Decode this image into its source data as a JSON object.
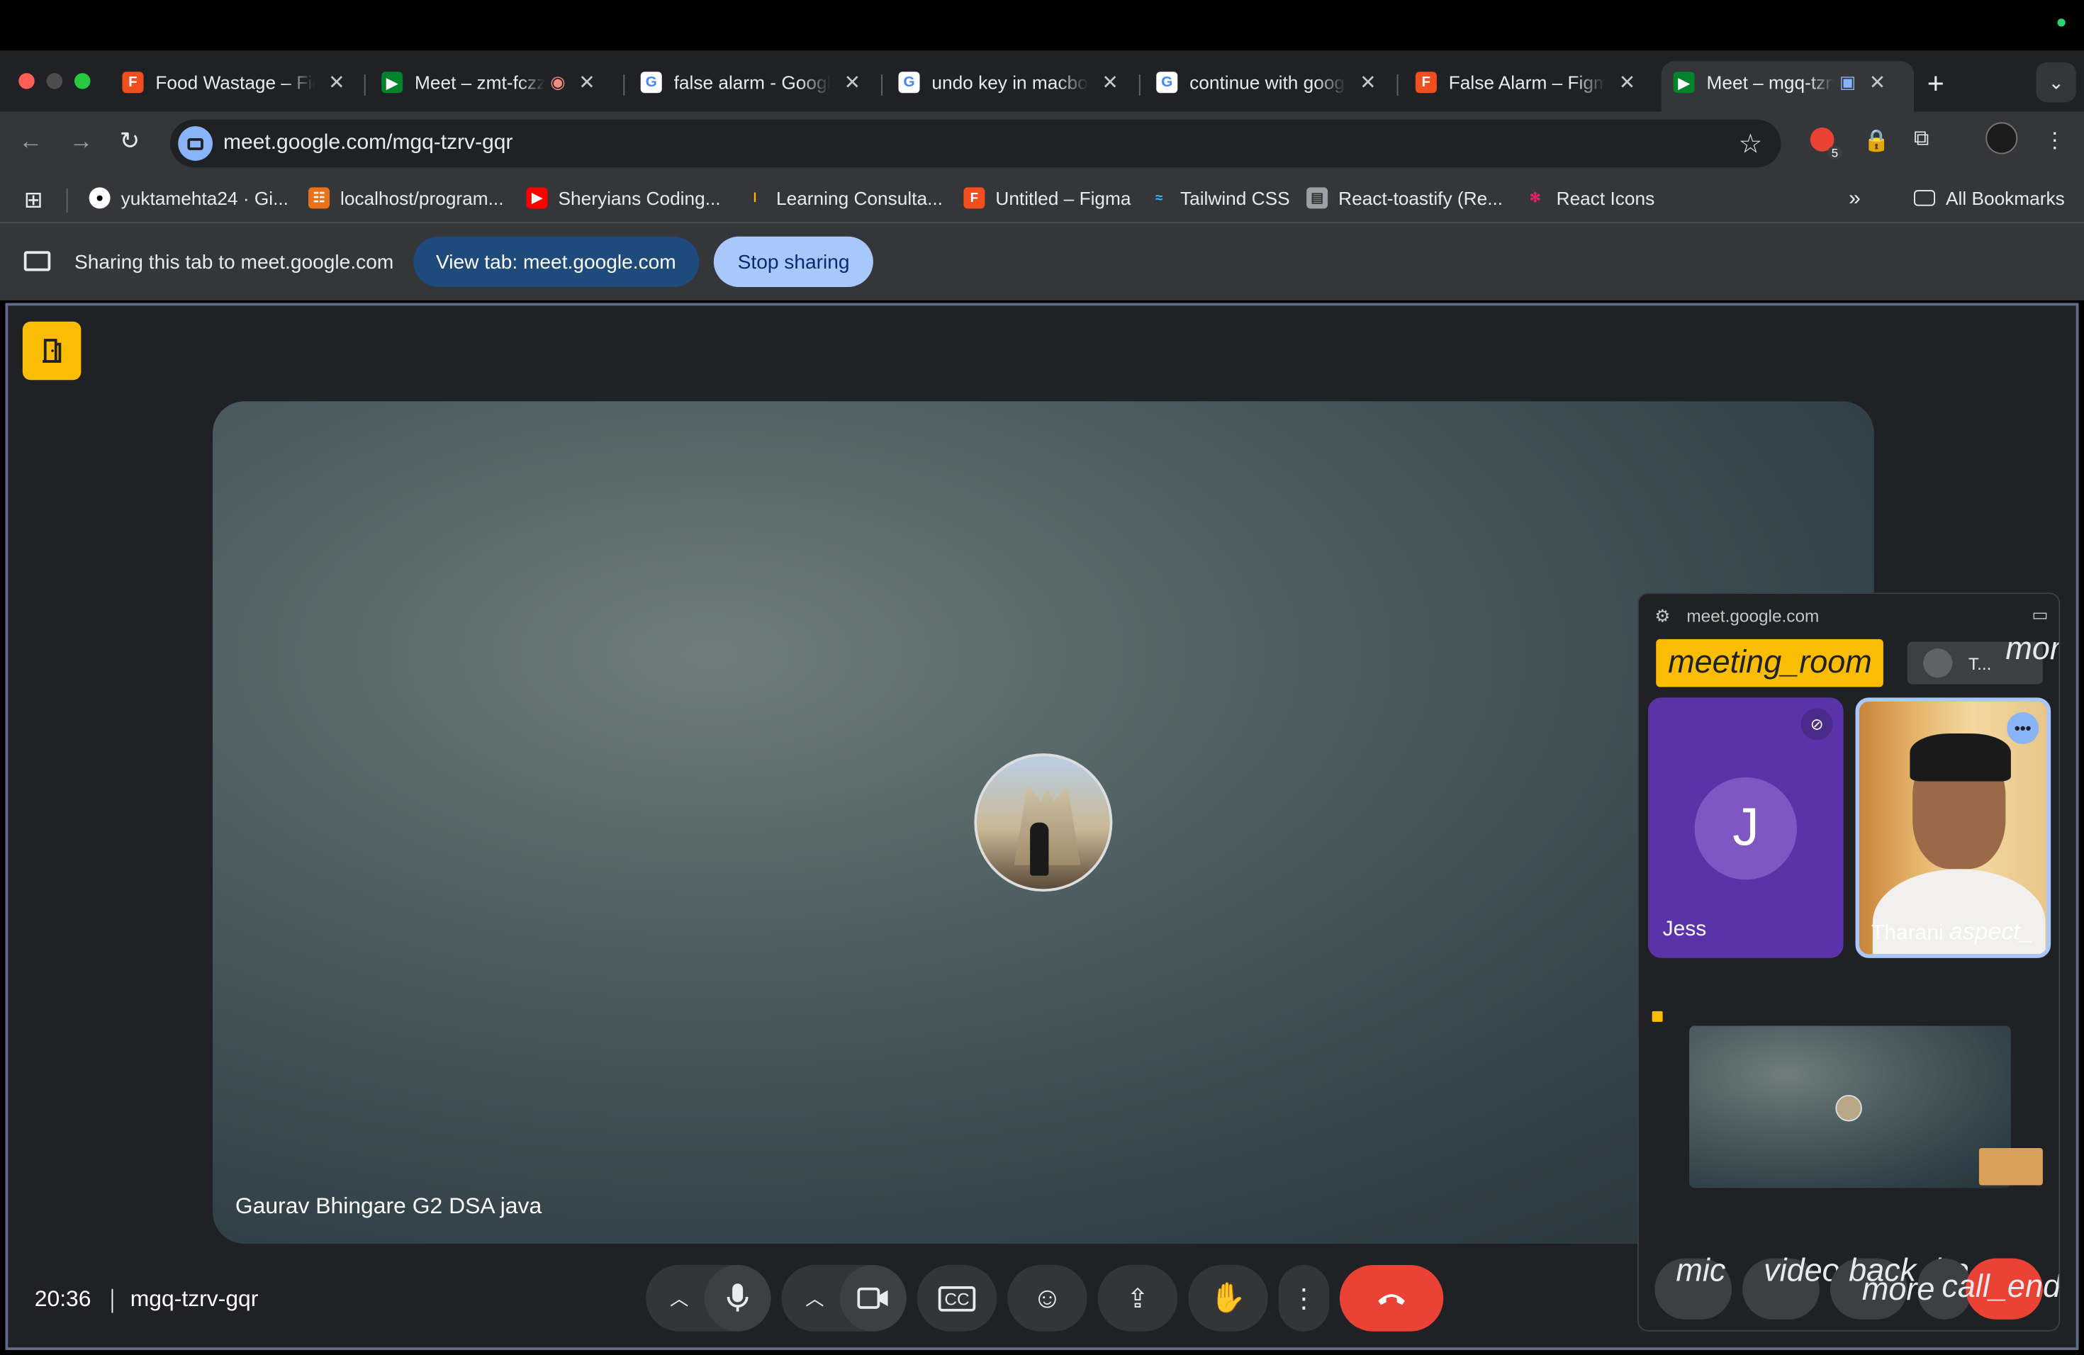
{
  "tabs": [
    {
      "title": "Food Wastage – Figma",
      "icon": "figma-icon"
    },
    {
      "title": "Meet – zmt-fczz",
      "icon": "meet-icon"
    },
    {
      "title": "false alarm - Google",
      "icon": "google-icon"
    },
    {
      "title": "undo key in macbook",
      "icon": "google-icon"
    },
    {
      "title": "continue with google",
      "icon": "google-icon"
    },
    {
      "title": "False Alarm – Figma",
      "icon": "figma-icon"
    },
    {
      "title": "Meet – mgq-tzrv",
      "icon": "meet-icon",
      "active": true
    }
  ],
  "toolbar": {
    "url": "meet.google.com/mgq-tzrv-gqr",
    "ext_badge": "5"
  },
  "bookmarks": [
    {
      "label": "yuktamehta24 · Gi...",
      "icon": "github-icon"
    },
    {
      "label": "localhost/program...",
      "icon": "localhost-icon"
    },
    {
      "label": "Sheryians Coding...",
      "icon": "youtube-icon"
    },
    {
      "label": "Learning Consulta...",
      "icon": "learning-icon"
    },
    {
      "label": "Untitled – Figma",
      "icon": "figma-icon"
    },
    {
      "label": "Tailwind CSS",
      "icon": "tailwind-icon"
    },
    {
      "label": "React-toastify (Re...",
      "icon": "toastify-icon"
    },
    {
      "label": "React Icons",
      "icon": "react-icon"
    }
  ],
  "all_bookmarks": "All Bookmarks",
  "sharebar": {
    "text": "Sharing this tab to meet.google.com",
    "view_label": "View tab: meet.google.com",
    "stop_label": "Stop sharing"
  },
  "meet": {
    "main_name": "Gaurav Bhingare G2 DSA java",
    "time": "20:36",
    "code": "mgq-tzrv-gqr"
  },
  "pip": {
    "host": "meet.google.com",
    "meeting_room": "meeting_room",
    "chip_name": "T...",
    "more": "mor",
    "jess_initial": "J",
    "jess_name": "Jess",
    "tharani_name": "Tharani",
    "tharani_suffix": "aspect_",
    "btn_mic": "mic",
    "btn_video": "videocam",
    "btn_back": "back_ha",
    "btn_more": "more",
    "btn_end": "call_end"
  },
  "colors": {
    "accent_blue": "#a8c7fa",
    "end_red": "#ea4335",
    "room_yellow": "#fbbc04",
    "jess_purple": "#5b33a8"
  }
}
